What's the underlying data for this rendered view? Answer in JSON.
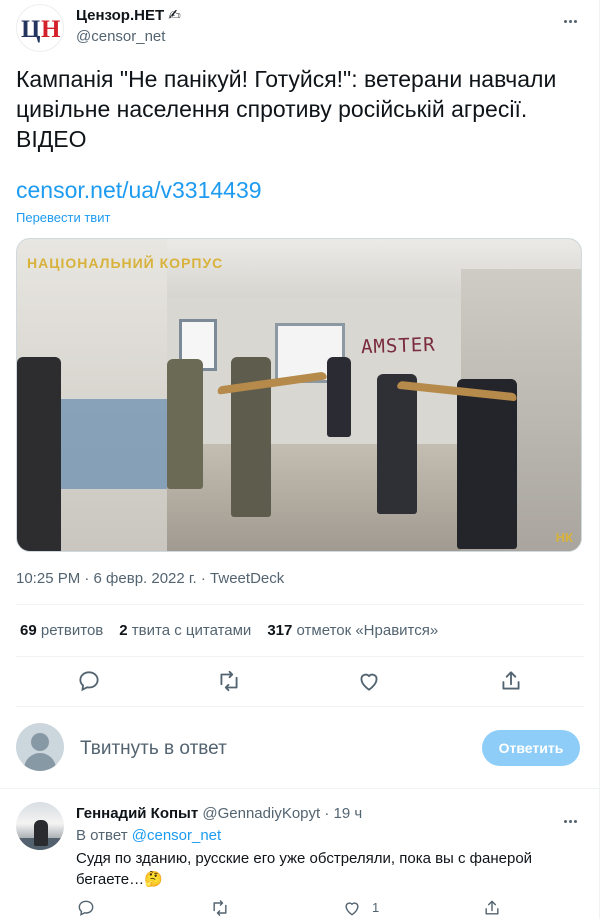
{
  "tweet": {
    "author_name": "Цензор.НЕТ ✍",
    "author_handle": "@censor_net",
    "logo_text_1": "Ц",
    "logo_text_2": "Н",
    "text": "Кампанія \"Не панікуй! Готуйся!\": ветерани навчали цивільне населення спротиву російській агресії. ВІДЕО",
    "link": "censor.net/ua/v3314439",
    "translate_label": "Перевести твит",
    "media": {
      "graffiti": "AMSTER",
      "watermark_top": "НАЦІОНАЛЬНИЙ КОРПУС",
      "watermark_corner": "НК"
    },
    "timestamp": "10:25 PM · 6 февр. 2022 г. · TweetDeck",
    "stats": {
      "retweets_count": "69",
      "retweets_label": "ретвитов",
      "quotes_count": "2",
      "quotes_label": "твита с цитатами",
      "likes_count": "317",
      "likes_label": "отметок «Нравится»"
    },
    "actions": [
      "reply-icon",
      "retweet-icon",
      "like-icon",
      "share-icon"
    ]
  },
  "reply_box": {
    "placeholder": "Твитнуть в ответ",
    "button_label": "Ответить",
    "button_color": "#8ecdf8"
  },
  "comment": {
    "name": "Геннадий Копыт",
    "handle": "@GennadiyKopyt",
    "time": "· 19 ч",
    "reply_to_prefix": "В ответ",
    "reply_to_handle": "@censor_net",
    "text": "Судя по зданию, русские его уже обстреляли, пока вы с фанерой бегаете…🤔",
    "like_count": "1"
  },
  "colors": {
    "accent": "#1d9bf0",
    "muted": "#536471",
    "text": "#0f1419"
  }
}
